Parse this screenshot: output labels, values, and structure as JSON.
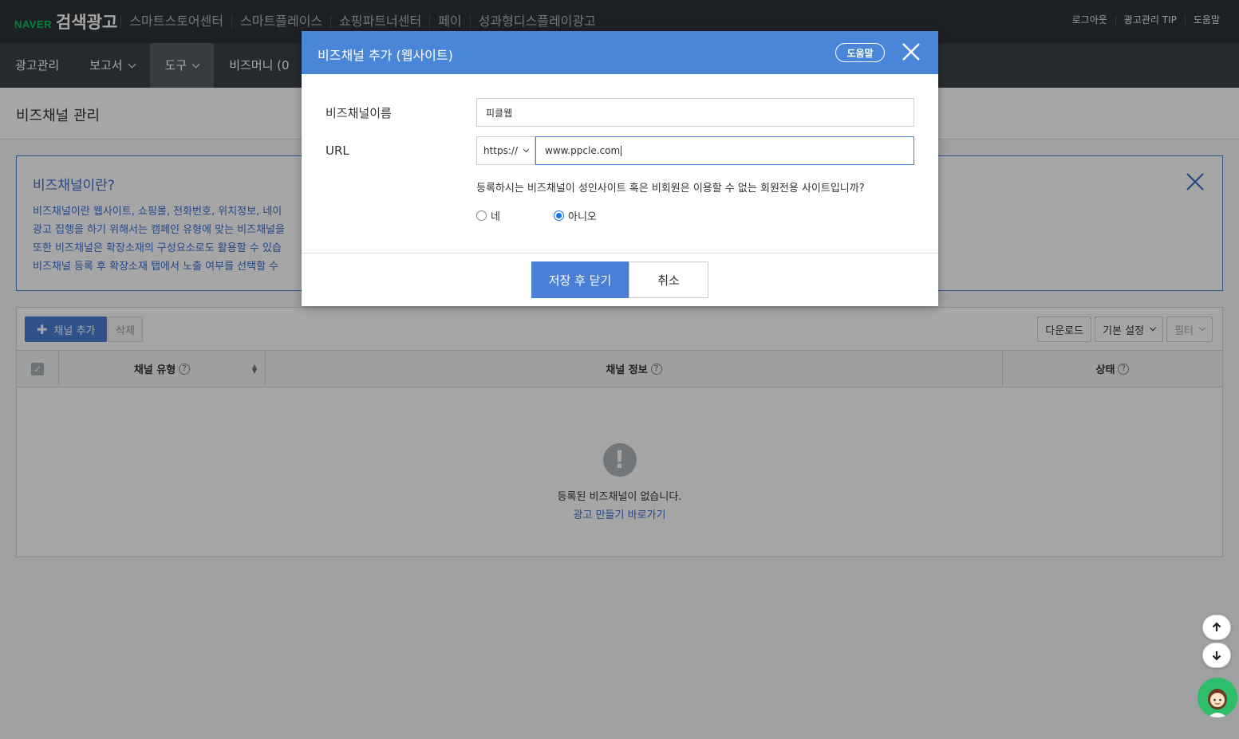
{
  "header": {
    "logo_naver": "NAVER",
    "logo_title": "검색광고",
    "service_links": [
      "스마트스토어센터",
      "스마트플레이스",
      "쇼핑파트너센터",
      "페이",
      "성과형디스플레이광고"
    ],
    "util_links": [
      "로그아웃",
      "광고관리 TIP",
      "도움말"
    ]
  },
  "nav": {
    "items": [
      {
        "label": "광고관리"
      },
      {
        "label": "보고서"
      },
      {
        "label": "도구"
      },
      {
        "label": "비즈머니 (0"
      }
    ]
  },
  "page": {
    "title": "비즈채널 관리"
  },
  "info": {
    "title": "비즈채널이란?",
    "lines": [
      "비즈채널이란 웹사이트, 쇼핑몰, 전화번호, 위치정보, 네이",
      "광고 집행을 하기 위해서는 캠페인 유형에 맞는 비즈채널을",
      "또한 비즈채널은 확장소재의 구성요소로도 활용할 수 있습",
      "비즈채널 등록 후 확장소재 탭에서 노출 여부를 선택할 수 "
    ]
  },
  "toolbar": {
    "add_label": "채널 추가",
    "delete_label": "삭제",
    "download_label": "다운로드",
    "settings_label": "기본 설정",
    "filter_label": "필터"
  },
  "grid": {
    "columns": [
      "채널 유형",
      "채널 정보",
      "상태"
    ],
    "empty_text": "등록된 비즈채널이 없습니다.",
    "empty_link": "광고 만들기 바로가기"
  },
  "modal": {
    "title": "비즈채널 추가 (웹사이트)",
    "help_label": "도움말",
    "name_label": "비즈채널이름",
    "name_value": "피클웹",
    "url_label": "URL",
    "protocol": "https://",
    "url_value": "www.ppcle.com",
    "question": "등록하시는 비즈채널이 성인사이트 혹은 비회원은 이용할 수 없는 회원전용 사이트입니까?",
    "option_yes": "네",
    "option_no": "아니오",
    "selected": "아니오",
    "save_label": "저장 후 닫기",
    "cancel_label": "취소"
  },
  "colors": {
    "accent": "#4a7fd5",
    "header_bg": "#2e3438",
    "nav_bg": "#3a4147",
    "naver_green": "#03c75a"
  }
}
